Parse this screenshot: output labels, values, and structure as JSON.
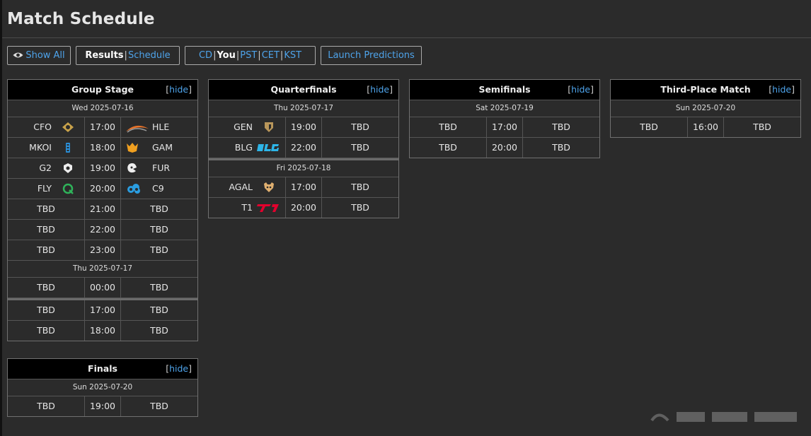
{
  "page": {
    "title": "Match Schedule"
  },
  "toolbar": {
    "show_all": "Show All",
    "results": "Results",
    "schedule": "Schedule",
    "sep": "|",
    "tz": [
      "CD",
      "You",
      "PST",
      "CET",
      "KST"
    ],
    "predictions": "Launch Predictions"
  },
  "hide_label": "hide",
  "bracket_open": "[",
  "bracket_close": "]",
  "group_stage": {
    "title": "Group Stage",
    "date1": "Wed 2025-07-16",
    "date2": "Thu 2025-07-17",
    "matches": [
      {
        "team1": "CFO",
        "time": "17:00",
        "team2": "HLE"
      },
      {
        "team1": "MKOI",
        "time": "18:00",
        "team2": "GAM"
      },
      {
        "team1": "G2",
        "time": "19:00",
        "team2": "FUR"
      },
      {
        "team1": "FLY",
        "time": "20:00",
        "team2": "C9"
      },
      {
        "team1": "TBD",
        "time": "21:00",
        "team2": "TBD"
      },
      {
        "team1": "TBD",
        "time": "22:00",
        "team2": "TBD"
      },
      {
        "team1": "TBD",
        "time": "23:00",
        "team2": "TBD"
      },
      {
        "team1": "TBD",
        "time": "00:00",
        "team2": "TBD"
      },
      {
        "team1": "TBD",
        "time": "17:00",
        "team2": "TBD"
      },
      {
        "team1": "TBD",
        "time": "18:00",
        "team2": "TBD"
      }
    ]
  },
  "quarterfinals": {
    "title": "Quarterfinals",
    "date1": "Thu 2025-07-17",
    "date2": "Fri 2025-07-18",
    "matches": [
      {
        "team1": "GEN",
        "time": "19:00",
        "team2": "TBD"
      },
      {
        "team1": "BLG",
        "time": "22:00",
        "team2": "TBD"
      },
      {
        "team1": "AGAL",
        "time": "17:00",
        "team2": "TBD"
      },
      {
        "team1": "T1",
        "time": "20:00",
        "team2": "TBD"
      }
    ]
  },
  "semifinals": {
    "title": "Semifinals",
    "date1": "Sat 2025-07-19",
    "matches": [
      {
        "team1": "TBD",
        "time": "17:00",
        "team2": "TBD"
      },
      {
        "team1": "TBD",
        "time": "20:00",
        "team2": "TBD"
      }
    ]
  },
  "third_place": {
    "title": "Third-Place Match",
    "date1": "Sun 2025-07-20",
    "matches": [
      {
        "team1": "TBD",
        "time": "16:00",
        "team2": "TBD"
      }
    ]
  },
  "finals": {
    "title": "Finals",
    "date1": "Sun 2025-07-20",
    "matches": [
      {
        "team1": "TBD",
        "time": "19:00",
        "team2": "TBD"
      }
    ]
  },
  "colors": {
    "link": "#4ea3ea",
    "header_bg": "#000000",
    "page_bg": "#2b2b2b"
  }
}
